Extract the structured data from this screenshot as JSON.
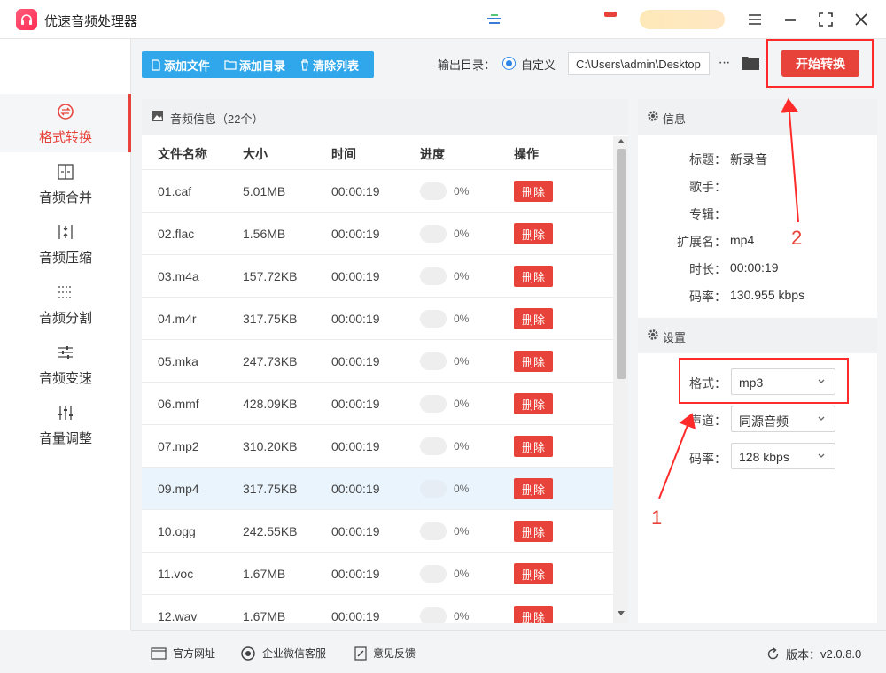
{
  "app": {
    "title": "优速音频处理器"
  },
  "sidebar": {
    "items": [
      {
        "label": "格式转换",
        "icon": "format-convert-icon",
        "active": true
      },
      {
        "label": "音频合并",
        "icon": "merge-icon"
      },
      {
        "label": "音频压缩",
        "icon": "compress-icon"
      },
      {
        "label": "音频分割",
        "icon": "split-icon"
      },
      {
        "label": "音频变速",
        "icon": "speed-icon"
      },
      {
        "label": "音量调整",
        "icon": "volume-icon"
      }
    ]
  },
  "toolbar": {
    "add_file": "添加文件",
    "add_folder": "添加目录",
    "clear_list": "清除列表",
    "output_label": "输出目录：",
    "custom_label": "自定义",
    "output_path": "C:\\Users\\admin\\Desktop",
    "more": "···",
    "start": "开始转换"
  },
  "file_panel": {
    "title": "音频信息（22个）",
    "columns": [
      "文件名称",
      "大小",
      "时间",
      "进度",
      "操作"
    ],
    "delete_label": "删除",
    "rows": [
      {
        "name": "01.caf",
        "size": "5.01MB",
        "time": "00:00:19",
        "progress": "0%"
      },
      {
        "name": "02.flac",
        "size": "1.56MB",
        "time": "00:00:19",
        "progress": "0%"
      },
      {
        "name": "03.m4a",
        "size": "157.72KB",
        "time": "00:00:19",
        "progress": "0%"
      },
      {
        "name": "04.m4r",
        "size": "317.75KB",
        "time": "00:00:19",
        "progress": "0%"
      },
      {
        "name": "05.mka",
        "size": "247.73KB",
        "time": "00:00:19",
        "progress": "0%"
      },
      {
        "name": "06.mmf",
        "size": "428.09KB",
        "time": "00:00:19",
        "progress": "0%"
      },
      {
        "name": "07.mp2",
        "size": "310.20KB",
        "time": "00:00:19",
        "progress": "0%"
      },
      {
        "name": "09.mp4",
        "size": "317.75KB",
        "time": "00:00:19",
        "progress": "0%"
      },
      {
        "name": "10.ogg",
        "size": "242.55KB",
        "time": "00:00:19",
        "progress": "0%"
      },
      {
        "name": "11.voc",
        "size": "1.67MB",
        "time": "00:00:19",
        "progress": "0%"
      },
      {
        "name": "12.wav",
        "size": "1.67MB",
        "time": "00:00:19",
        "progress": "0%"
      }
    ]
  },
  "info": {
    "title": "信息",
    "fields": [
      {
        "k": "标题：",
        "v": "新录音"
      },
      {
        "k": "歌手：",
        "v": ""
      },
      {
        "k": "专辑：",
        "v": ""
      },
      {
        "k": "扩展名：",
        "v": "mp4"
      },
      {
        "k": "时长：",
        "v": "00:00:19"
      },
      {
        "k": "码率：",
        "v": "130.955 kbps"
      }
    ]
  },
  "settings": {
    "title": "设置",
    "format_label": "格式：",
    "format_value": "mp3",
    "channel_label": "声道：",
    "channel_value": "同源音频",
    "bitrate_label": "码率：",
    "bitrate_value": "128 kbps"
  },
  "annotations": {
    "one": "1",
    "two": "2"
  },
  "footer": {
    "website": "官方网址",
    "wechat": "企业微信客服",
    "feedback": "意见反馈",
    "version_label": "版本：",
    "version": "v2.0.8.0"
  },
  "colors": {
    "accent": "#e8433a",
    "blue": "#30a7ea",
    "selected_row": "#eaf4fd"
  }
}
